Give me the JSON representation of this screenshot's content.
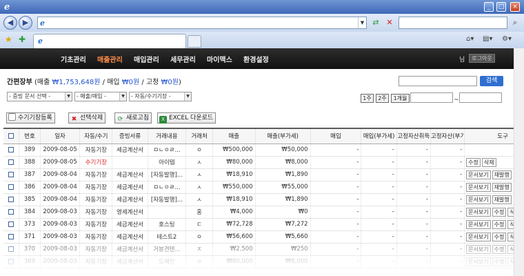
{
  "browser": {
    "address_value": "",
    "search_value": "",
    "tab_title": ""
  },
  "menu": {
    "items": [
      "기초관리",
      "매출관리",
      "매입관리",
      "세무관리",
      "마이맥스",
      "환경설정"
    ],
    "active_index": 1,
    "user_suffix": "님",
    "logout_label": "로그아웃"
  },
  "summary": {
    "title": "간편장부",
    "open": " (매출 ",
    "sales": "₩1,753,648원",
    "sep1": " / 매입 ",
    "purchase": "₩0원",
    "sep2": " / 고정 ",
    "fixed": "₩0원",
    "close": ")"
  },
  "search": {
    "keyword": "",
    "button": "검색"
  },
  "filters": {
    "doc_select": "- 증빙 문서 선택 -",
    "type_select": "- 매출/매입 -",
    "mode_select": "- 자동/수기기장 -",
    "period_buttons": [
      "1주",
      "2주",
      "1개월"
    ],
    "date_from": "",
    "date_sep": "~",
    "date_to": ""
  },
  "actions": {
    "add_manual": "수기기장등록",
    "delete_selected": "선택삭제",
    "refresh": "새로고침",
    "excel": "EXCEL 다운로드"
  },
  "table": {
    "headers": [
      "",
      "번호",
      "일자",
      "자동/수기",
      "증빙서류",
      "거래내용",
      "거래처",
      "매출",
      "매출(부가세)",
      "매입",
      "매입(부가세)",
      "고정자산취득",
      "고정자산(부가세)",
      "도구"
    ],
    "rows": [
      {
        "no": "389",
        "date": "2009-08-05",
        "mode": "자동기장",
        "doc": "세금계산서",
        "desc": "ㅁㄴㅇㄹ...",
        "vendor": "ㅇ",
        "sales": "₩500,000",
        "sales_vat": "₩50,000",
        "buy": "-",
        "buy_vat": "-",
        "asset": "-",
        "asset_vat": "-",
        "tools": []
      },
      {
        "no": "388",
        "date": "2009-08-05",
        "mode": "수기기장",
        "doc": "",
        "desc": "아이템",
        "vendor": "ㅅ",
        "sales": "₩80,000",
        "sales_vat": "₩8,000",
        "buy": "-",
        "buy_vat": "-",
        "asset": "-",
        "asset_vat": "-",
        "tools": [
          "수정",
          "삭제"
        ]
      },
      {
        "no": "387",
        "date": "2009-08-04",
        "mode": "자동기장",
        "doc": "세금계산서",
        "desc": "[자동발행]...",
        "vendor": "ㅅ",
        "sales": "₩18,910",
        "sales_vat": "₩1,890",
        "buy": "-",
        "buy_vat": "-",
        "asset": "-",
        "asset_vat": "-",
        "tools": [
          "문서보기",
          "재발행"
        ]
      },
      {
        "no": "386",
        "date": "2009-08-04",
        "mode": "자동기장",
        "doc": "세금계산서",
        "desc": "ㅁㄴㅇㄹ...",
        "vendor": "ㅅ",
        "sales": "₩550,000",
        "sales_vat": "₩55,000",
        "buy": "-",
        "buy_vat": "-",
        "asset": "-",
        "asset_vat": "-",
        "tools": [
          "문서보기",
          "재발행"
        ]
      },
      {
        "no": "385",
        "date": "2009-08-04",
        "mode": "자동기장",
        "doc": "세금계산서",
        "desc": "[자동발행]...",
        "vendor": "ㅅ",
        "sales": "₩18,910",
        "sales_vat": "₩1,890",
        "buy": "-",
        "buy_vat": "-",
        "asset": "-",
        "asset_vat": "-",
        "tools": [
          "문서보기",
          "재발행"
        ]
      },
      {
        "no": "384",
        "date": "2009-08-03",
        "mode": "자동기장",
        "doc": "영세계산서",
        "desc": "",
        "vendor": "홍",
        "sales": "₩4,000",
        "sales_vat": "₩0",
        "buy": "-",
        "buy_vat": "-",
        "asset": "-",
        "asset_vat": "-",
        "tools": [
          "문서보기",
          "수정",
          "삭"
        ]
      },
      {
        "no": "373",
        "date": "2009-08-03",
        "mode": "자동기장",
        "doc": "세금계산서",
        "desc": "호스팅",
        "vendor": "ㄷ",
        "sales": "₩72,728",
        "sales_vat": "₩7,272",
        "buy": "-",
        "buy_vat": "-",
        "asset": "-",
        "asset_vat": "-",
        "tools": [
          "문서보기",
          "수정",
          "삭"
        ]
      },
      {
        "no": "371",
        "date": "2009-08-03",
        "mode": "자동기장",
        "doc": "세금계산서",
        "desc": "테스트2",
        "vendor": "ㅇ",
        "sales": "₩56,600",
        "sales_vat": "₩5,660",
        "buy": "-",
        "buy_vat": "-",
        "asset": "-",
        "asset_vat": "-",
        "tools": [
          "문서보기",
          "수정",
          "삭"
        ]
      },
      {
        "no": "370",
        "date": "2009-08-03",
        "mode": "자동기장",
        "doc": "세금계산서",
        "desc": "거봉견텐...",
        "vendor": "ㅈ",
        "sales": "₩2,500",
        "sales_vat": "₩250",
        "buy": "-",
        "buy_vat": "-",
        "asset": "-",
        "asset_vat": "-",
        "tools": [
          "문서보기",
          "수정",
          "삭"
        ]
      },
      {
        "no": "369",
        "date": "2009-08-03",
        "mode": "자동기장",
        "doc": "세금계산서",
        "desc": "도메인",
        "vendor": "ㅇ",
        "sales": "₩80,000",
        "sales_vat": "₩8,000",
        "buy": "-",
        "buy_vat": "-",
        "asset": "-",
        "asset_vat": "-",
        "tools": [
          "문서보기",
          "수정",
          "삭"
        ]
      }
    ]
  }
}
